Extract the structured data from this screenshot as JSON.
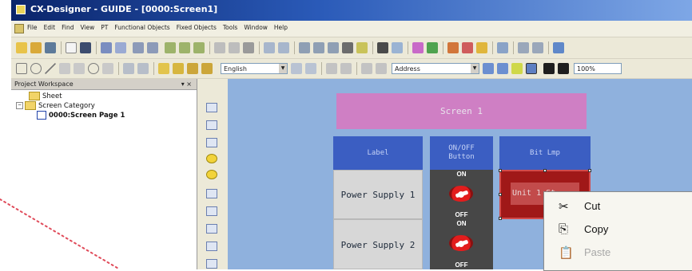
{
  "window": {
    "title": "CX-Designer - GUIDE - [0000:Screen1]"
  },
  "menu": {
    "items": [
      "File",
      "Edit",
      "Find",
      "View",
      "PT",
      "Functional Objects",
      "Fixed Objects",
      "Tools",
      "Window",
      "Help"
    ]
  },
  "toolbar": {
    "language": "English",
    "address_mode": "Address",
    "zoom": "100%"
  },
  "workspace": {
    "title": "Project Workspace",
    "controls": "▾ ×",
    "tree": [
      {
        "label": "Sheet"
      },
      {
        "label": "Screen Category"
      },
      {
        "label": "0000:Screen Page 1"
      }
    ]
  },
  "screen": {
    "title": "Screen 1",
    "headers": {
      "label": "Label",
      "onoff_line1": "ON/OFF",
      "onoff_line2": "Button",
      "bitlamp": "Bit Lmp"
    },
    "rows": [
      {
        "label": "Power Supply 1",
        "on": "ON",
        "off": "OFF"
      },
      {
        "label": "Power Supply 2",
        "on": "ON",
        "off": "OFF"
      }
    ],
    "bitlamp_text": "Unit 1 St"
  },
  "context_menu": {
    "items": [
      {
        "label": "Cut",
        "icon": "scissors-icon",
        "enabled": true
      },
      {
        "label": "Copy",
        "icon": "copy-icon",
        "enabled": true
      },
      {
        "label": "Paste",
        "icon": "paste-icon",
        "enabled": false
      }
    ]
  },
  "colors": {
    "canvas": "#8fb1dd",
    "screen_title_bg": "#cf7fc4",
    "header_bg": "#3b5ec2",
    "bitlamp_bg": "#a01818"
  }
}
